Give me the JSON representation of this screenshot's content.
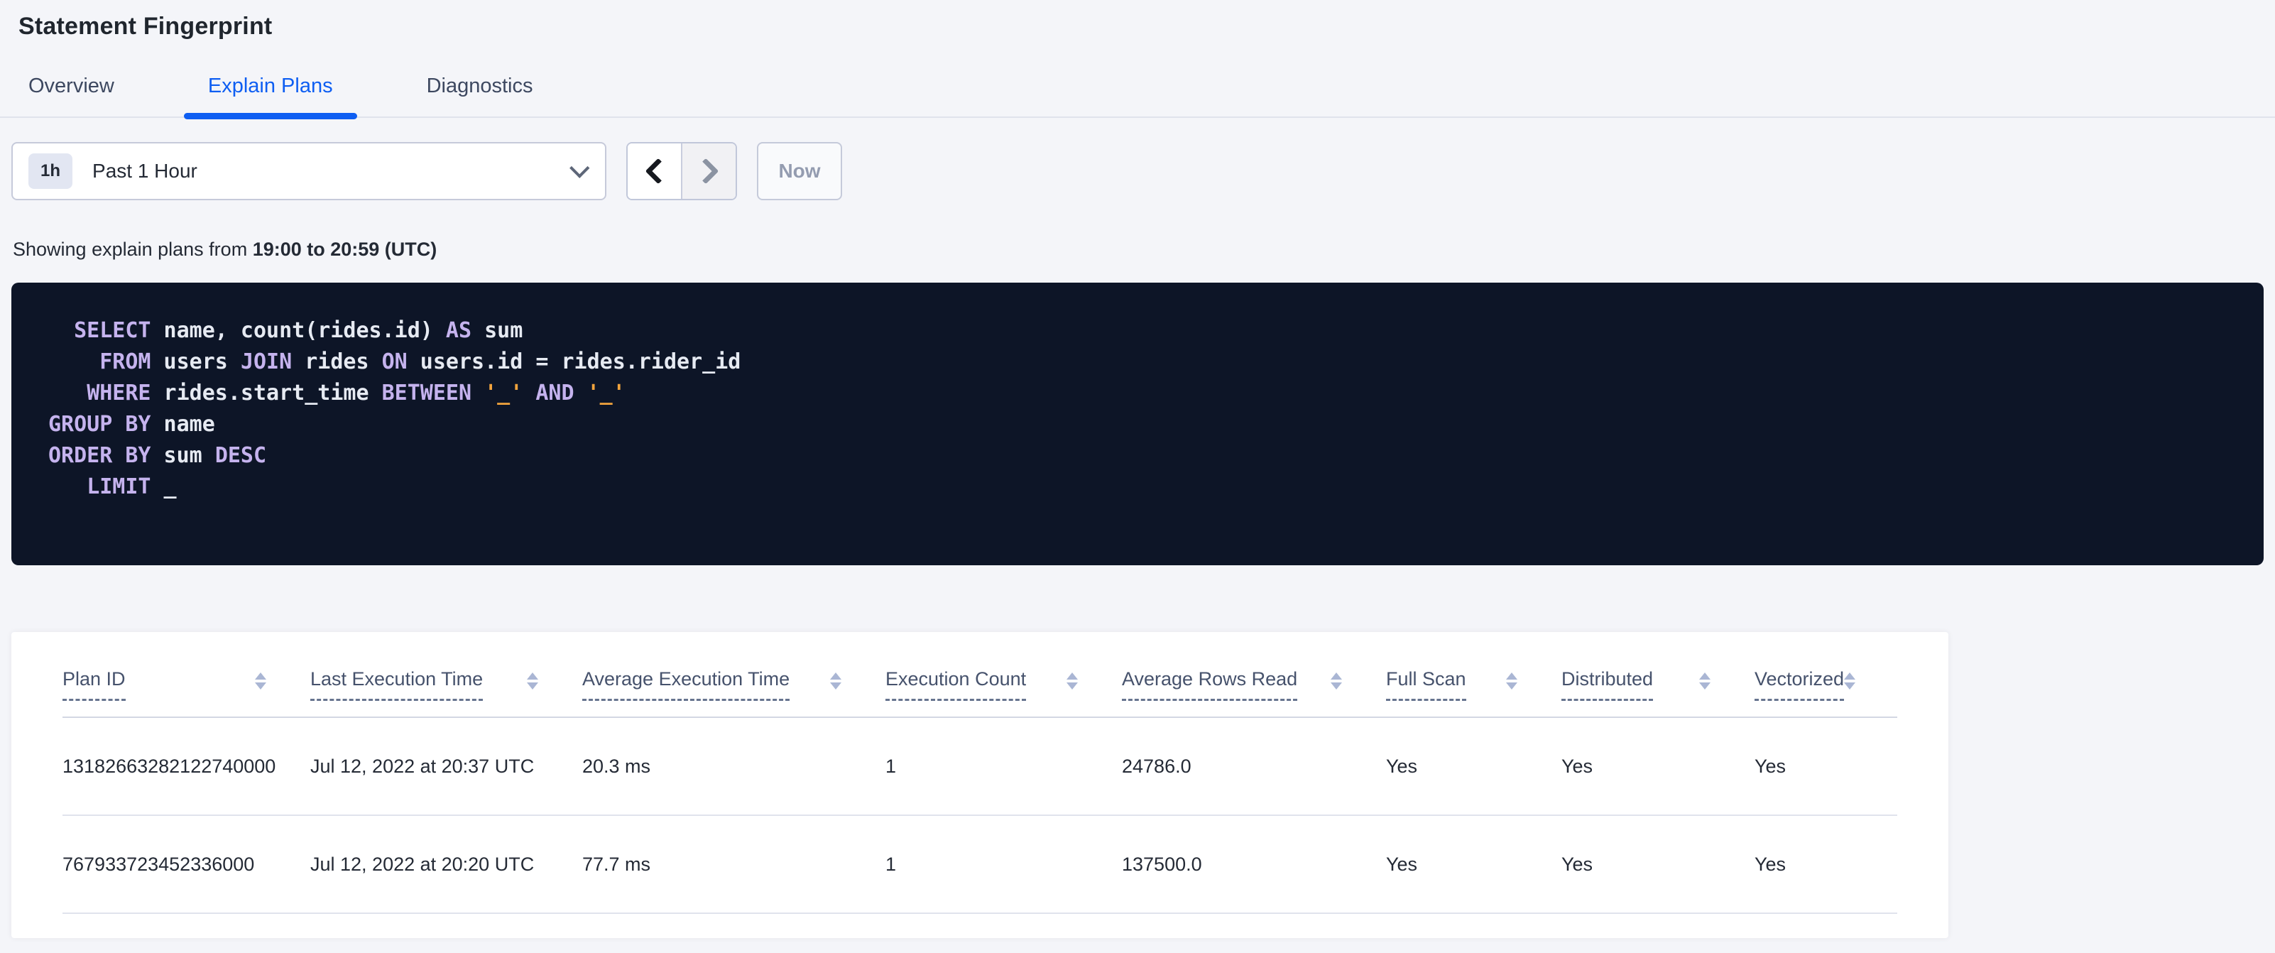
{
  "header": {
    "title": "Statement Fingerprint"
  },
  "tabs": [
    {
      "label": "Overview",
      "active": false
    },
    {
      "label": "Explain Plans",
      "active": true
    },
    {
      "label": "Diagnostics",
      "active": false
    }
  ],
  "toolbar": {
    "time_range_badge": "1h",
    "time_range_label": "Past 1 Hour",
    "now_label": "Now",
    "icons": {
      "dropdown": "chevron-down-icon",
      "previous": "chevron-left-icon",
      "next": "chevron-right-icon"
    }
  },
  "summary": {
    "prefix": "Showing explain plans from ",
    "range": "19:00 to 20:59 (UTC)"
  },
  "sql": {
    "lines": [
      {
        "segments": [
          {
            "text": "  ",
            "type": "plain"
          },
          {
            "text": "SELECT",
            "type": "kw"
          },
          {
            "text": " name, count(rides.id) ",
            "type": "plain"
          },
          {
            "text": "AS",
            "type": "kw"
          },
          {
            "text": " sum",
            "type": "plain"
          }
        ]
      },
      {
        "segments": [
          {
            "text": "    ",
            "type": "plain"
          },
          {
            "text": "FROM",
            "type": "kw"
          },
          {
            "text": " users ",
            "type": "plain"
          },
          {
            "text": "JOIN",
            "type": "kw"
          },
          {
            "text": " rides ",
            "type": "plain"
          },
          {
            "text": "ON",
            "type": "kw"
          },
          {
            "text": " users.id = rides.rider_id",
            "type": "plain"
          }
        ]
      },
      {
        "segments": [
          {
            "text": "   ",
            "type": "plain"
          },
          {
            "text": "WHERE",
            "type": "kw"
          },
          {
            "text": " rides.start_time ",
            "type": "plain"
          },
          {
            "text": "BETWEEN",
            "type": "kw"
          },
          {
            "text": " ",
            "type": "plain"
          },
          {
            "text": "'_'",
            "type": "lit"
          },
          {
            "text": " ",
            "type": "plain"
          },
          {
            "text": "AND",
            "type": "kw"
          },
          {
            "text": " ",
            "type": "plain"
          },
          {
            "text": "'_'",
            "type": "lit"
          }
        ]
      },
      {
        "segments": [
          {
            "text": "GROUP BY",
            "type": "kw"
          },
          {
            "text": " name",
            "type": "plain"
          }
        ]
      },
      {
        "segments": [
          {
            "text": "ORDER BY",
            "type": "kw"
          },
          {
            "text": " sum ",
            "type": "plain"
          },
          {
            "text": "DESC",
            "type": "kw"
          }
        ]
      },
      {
        "segments": [
          {
            "text": "   ",
            "type": "plain"
          },
          {
            "text": "LIMIT",
            "type": "kw"
          },
          {
            "text": " _",
            "type": "plain"
          }
        ]
      }
    ]
  },
  "plans_table": {
    "columns": [
      {
        "label": "Plan ID",
        "sortable": true
      },
      {
        "label": "Last Execution Time",
        "sortable": true
      },
      {
        "label": "Average Execution Time",
        "sortable": true
      },
      {
        "label": "Execution Count",
        "sortable": true
      },
      {
        "label": "Average Rows Read",
        "sortable": true
      },
      {
        "label": "Full Scan",
        "sortable": true
      },
      {
        "label": "Distributed",
        "sortable": true
      },
      {
        "label": "Vectorized",
        "sortable": true
      }
    ],
    "rows": [
      {
        "cells": [
          "13182663282122740000",
          "Jul 12, 2022 at 20:37 UTC",
          "20.3 ms",
          "1",
          "24786.0",
          "Yes",
          "Yes",
          "Yes"
        ]
      },
      {
        "cells": [
          "767933723452336000",
          "Jul 12, 2022 at 20:20 UTC",
          "77.7 ms",
          "1",
          "137500.0",
          "Yes",
          "Yes",
          "Yes"
        ]
      }
    ]
  },
  "colors": {
    "accent_blue": "#0e5ef2",
    "page_background": "#f4f5f9",
    "sql_background": "#0d1527",
    "sql_keyword": "#c5b3ee",
    "sql_literal": "#f2a43d",
    "sql_text": "#e6eaf2",
    "sort_arrow": "#aab6d4"
  }
}
